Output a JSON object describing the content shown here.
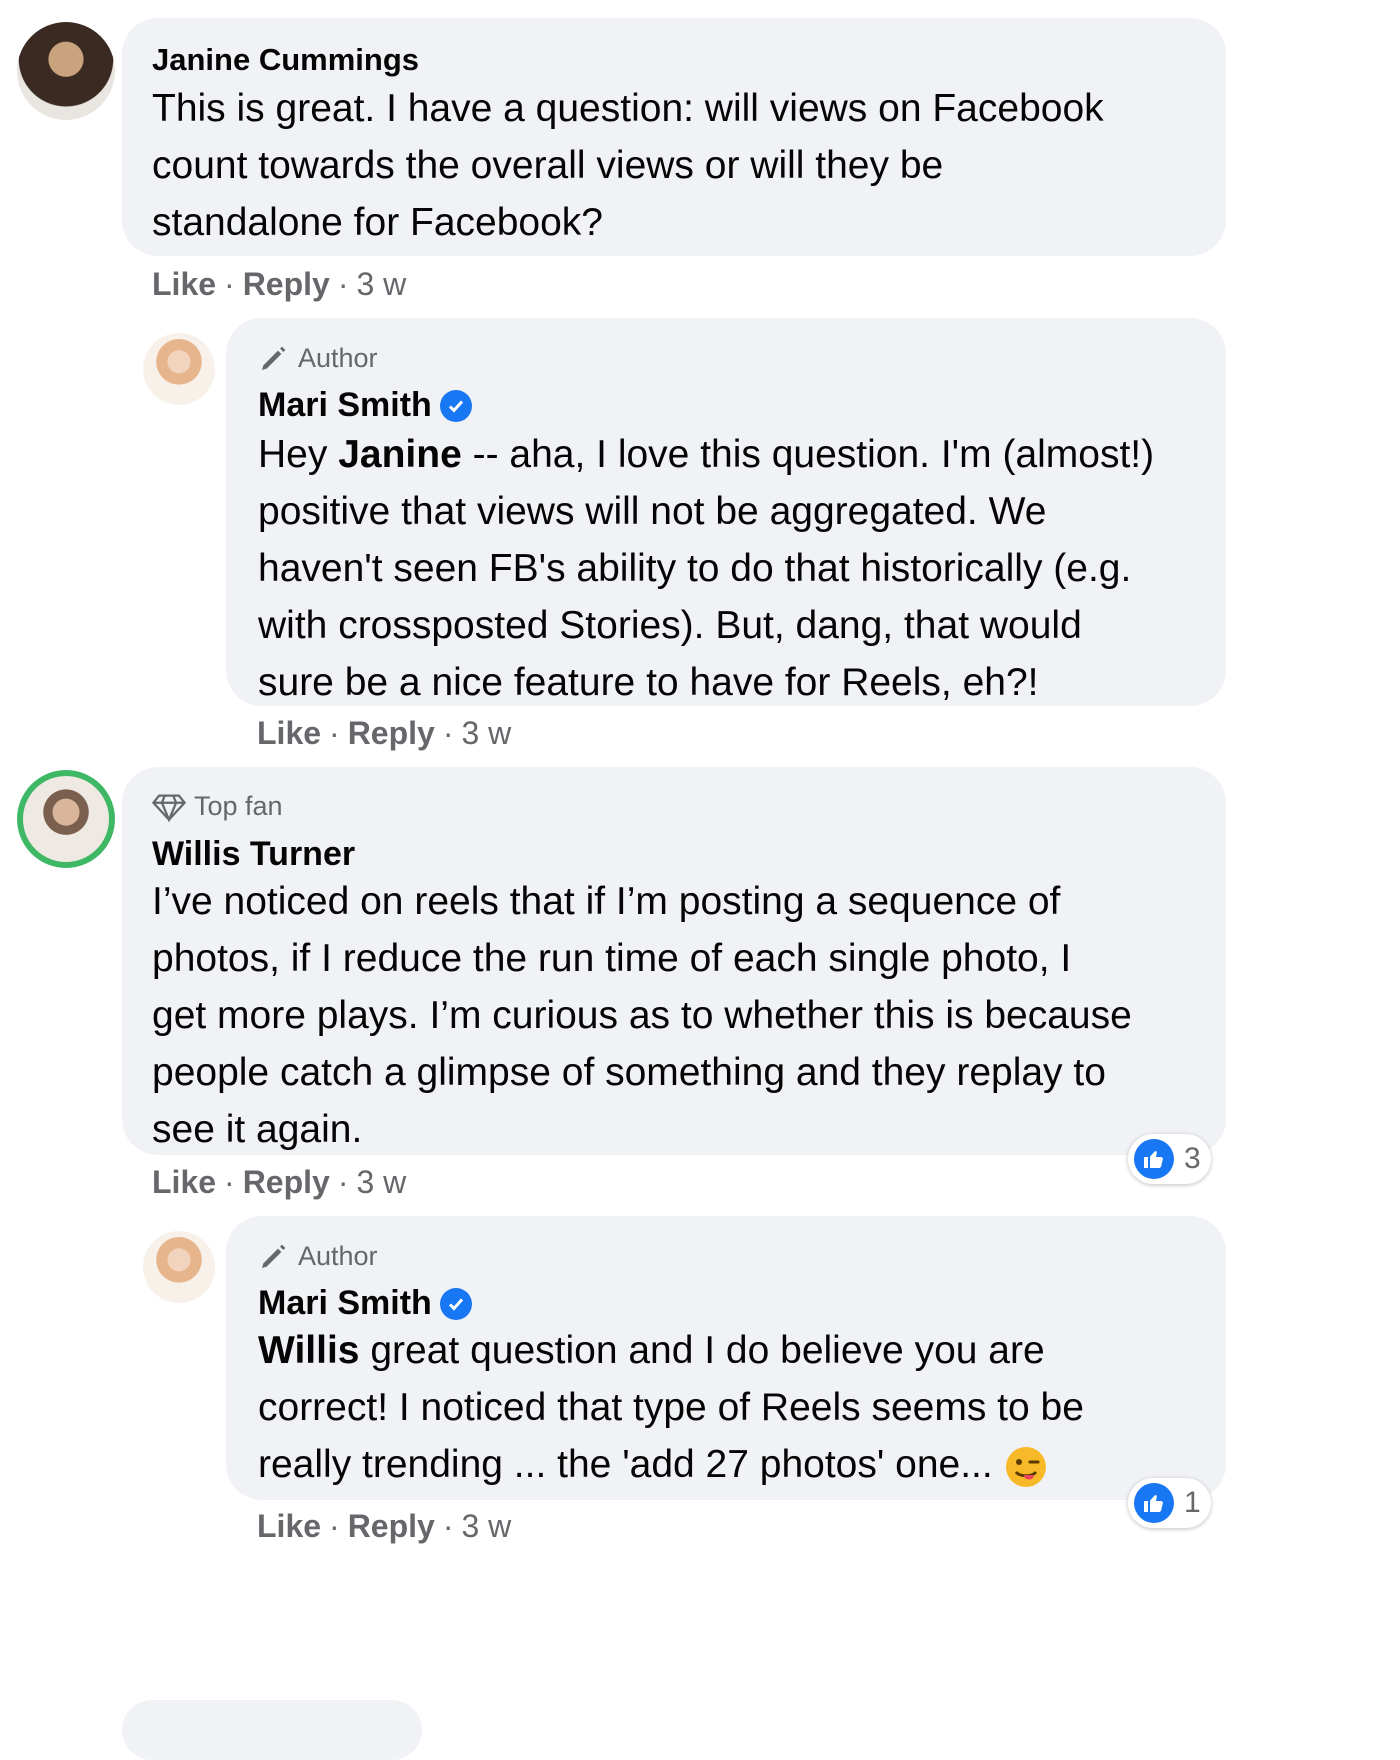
{
  "comments": [
    {
      "name": "Janine Cummings",
      "text": "This is great. I have a question: will views on Facebook\ncount towards the overall views or will they be\nstandalone for Facebook?",
      "like": "Like",
      "reply": "Reply",
      "time": "3 w"
    },
    {
      "badge": "Author",
      "name": "Mari Smith",
      "mention": "Janine",
      "text_prefix": "Hey ",
      "text": " -- aha, I love this question. I'm (almost!)\npositive that views will not be aggregated. We\nhaven't seen FB's ability to do that historically (e.g.\nwith crossposted Stories). But, dang, that would\nsure be a nice feature to have for Reels, eh?!",
      "like": "Like",
      "reply": "Reply",
      "time": "3 w"
    },
    {
      "badge": "Top fan",
      "name": "Willis Turner",
      "text": "I’ve noticed on reels that if I’m posting a sequence of\nphotos, if I reduce the run time of each single photo, I\nget more plays. I’m curious as to whether this is because\npeople catch a glimpse of something and they replay to\nsee it again.",
      "like": "Like",
      "reply": "Reply",
      "time": "3 w",
      "reaction_count": "3"
    },
    {
      "badge": "Author",
      "name": "Mari Smith",
      "mention": "Willis",
      "text": " great question and I do believe you are\ncorrect! I noticed that type of Reels seems to be\nreally trending ... the 'add 27 photos' one...",
      "like": "Like",
      "reply": "Reply",
      "time": "3 w",
      "reaction_count": "1"
    }
  ],
  "colors": {
    "bubble": "#f0f2f5",
    "accent": "#1877f2",
    "meta": "#65676b",
    "top_fan_ring": "#3fb866"
  },
  "icons": [
    "pencil-icon",
    "diamond-icon",
    "verified-icon",
    "thumbs-up-icon",
    "wink-tongue-emoji-icon"
  ]
}
